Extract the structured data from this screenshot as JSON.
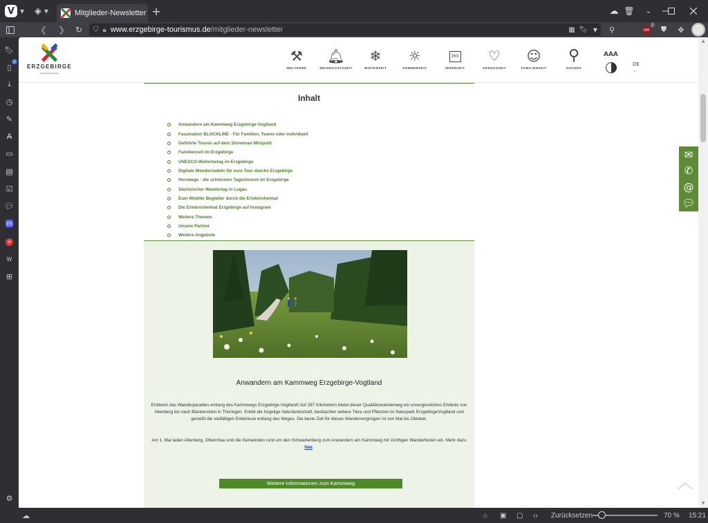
{
  "browser": {
    "tab_title": "Mitglieder-Newsletter",
    "new_tab": "+",
    "url_domain": "www.erzgebirge-tourismus.de",
    "url_path": "/mitglieder-newsletter",
    "ublock_count": "2",
    "panel_badge": "2"
  },
  "statusbar": {
    "reset_label": "Zurücksetzen",
    "zoom": "70 %",
    "time": "15:21",
    "zoom_fraction": 0.1
  },
  "site": {
    "logo_text": "ERZGEBIRGE",
    "logo_colors": [
      "#d42a2a",
      "#2a8a3a",
      "#f0b400",
      "#1e5aa8"
    ],
    "nav": [
      {
        "label": "WELTERBE",
        "icon": "hammer-pick-icon"
      },
      {
        "label": "WEIHNACHTSZEIT",
        "icon": "bells-icon"
      },
      {
        "label": "WINTERZEIT",
        "icon": "snowflake-icon"
      },
      {
        "label": "SOMMERZEIT",
        "icon": "sun-icon"
      },
      {
        "label": "JEDERZEIT",
        "icon": "calendar-365-icon"
      },
      {
        "label": "GENUSSZEIT",
        "icon": "heart-icon"
      },
      {
        "label": "FAMILIENZEIT",
        "icon": "family-icon"
      },
      {
        "label": "SUCHEN",
        "icon": "search-icon"
      }
    ],
    "font_size_label": "AAA",
    "language": "DE",
    "accent_color": "#5e8c36"
  },
  "toc": {
    "title": "Inhalt",
    "items": [
      "Anwandern am Kammweg Erzgebirge-Vogtland",
      "Faszination BLOCKLINE - Für Familien, Teams oder individuell",
      "Geführte Touren auf dem Stoneman Miriquidi",
      "Familienzeit im Erzgebirge",
      "UNESCO-Welterbetag im Erzgebirge",
      "Digitale Wandernadeln für eure Tour durchs Erzgebirge",
      "Herzwege - die schönsten Tagestouren im Erzgebirge",
      "Sächsischer Wandertag in Lugau",
      "Euer Mobiler Begleiter durch die Erlebnisheimat",
      "Die Erlebnisheimat Erzgebirge auf Instagram",
      "Weitere Themen",
      "Unsere Partner",
      "Weitere Angebote"
    ]
  },
  "article": {
    "title": "Anwandern am Kammweg Erzgebirge-Vogtland",
    "paragraph1": "Entdeckt das Wanderparadies entlang des Kammwegs Erzgebirge-Vogtland! Auf 287 Kilometern bietet dieser Qualitätswanderweg ein unvergessliches Erlebnis von Altenberg bis nach Blankenstein in Thüringen. Erlebt die hügelige Naturlandschaft, beobachtet seltene Tiere und Pflanzen im Naturpark Erzgebirge/Vogtland und genießt die vielfältigen Erlebnisse entlang des Weges. Die beste Zeit für dieses Wandervergnügen ist von Mai bis Oktober.",
    "paragraph2": "Am 1. Mai laden Altenberg, Olbernhau und die Gemeinden rund um den Schwartenberg zum Anwandern am Kammweg mit zünftigen Wanderfesten ein. Mehr dazu ",
    "link_text": "hier",
    "paragraph2_end": ".",
    "button_label": "Weitere Informationen zum Kammweg"
  }
}
